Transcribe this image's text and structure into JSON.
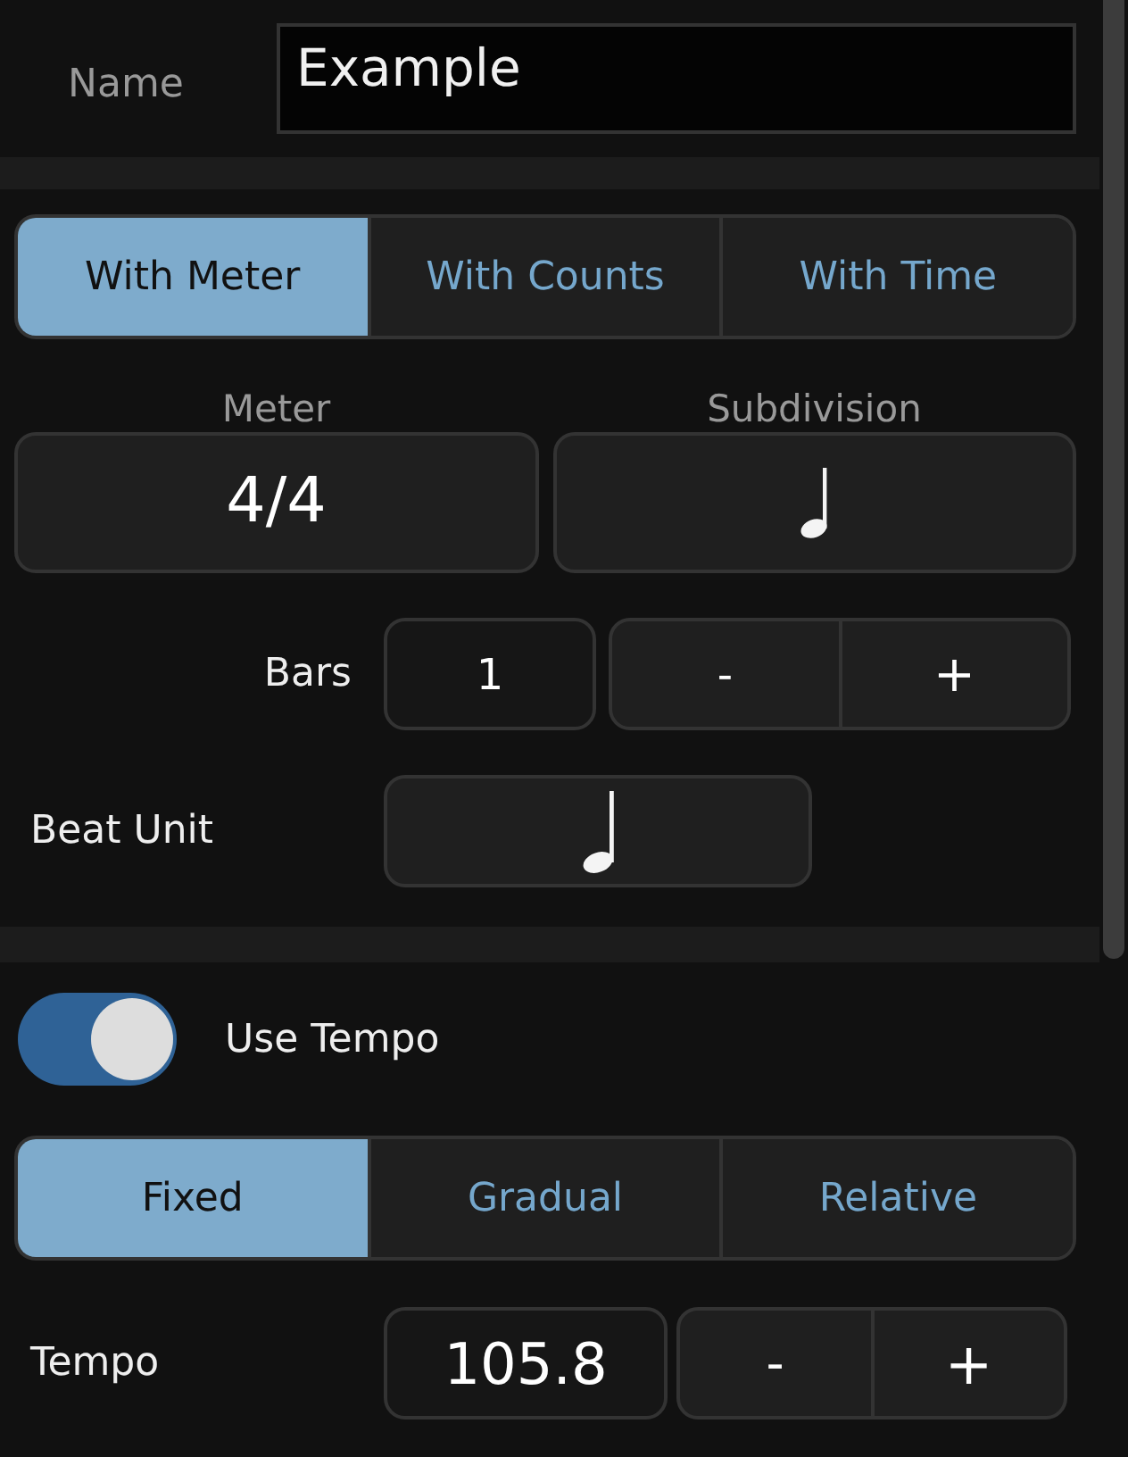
{
  "name_field": {
    "label": "Name",
    "value": "Example"
  },
  "mode_tabs": [
    {
      "label": "With Meter",
      "selected": true
    },
    {
      "label": "With Counts",
      "selected": false
    },
    {
      "label": "With Time",
      "selected": false
    }
  ],
  "meter": {
    "label": "Meter",
    "value": "4/4"
  },
  "subdivision": {
    "label": "Subdivision"
  },
  "bars": {
    "label": "Bars",
    "value": "1",
    "decrement": "-",
    "increment": "+"
  },
  "beat_unit": {
    "label": "Beat Unit"
  },
  "use_tempo": {
    "label": "Use Tempo",
    "on": true
  },
  "tempo_tabs": [
    {
      "label": "Fixed",
      "selected": true
    },
    {
      "label": "Gradual",
      "selected": false
    },
    {
      "label": "Relative",
      "selected": false
    }
  ],
  "tempo": {
    "label": "Tempo",
    "value": "105.8",
    "decrement": "-",
    "increment": "+"
  }
}
